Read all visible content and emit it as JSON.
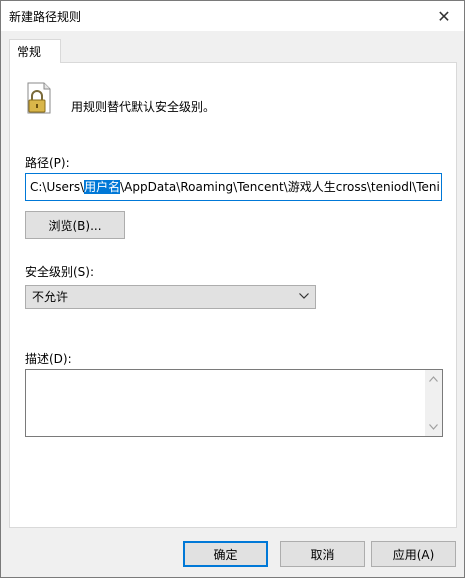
{
  "window": {
    "title": "新建路径规则",
    "close_glyph": "✕"
  },
  "tabs": [
    {
      "label": "常规"
    }
  ],
  "general": {
    "description": "用规则替代默认安全级别。",
    "path_label": "路径(P):",
    "path_value_prefix": "C:\\Users\\",
    "path_value_selected": "用户名",
    "path_value_suffix": "\\AppData\\Roaming\\Tencent\\游戏人生cross\\teniodl\\Teni",
    "browse_label": "浏览(B)...",
    "security_level_label": "安全级别(S):",
    "security_level_value": "不允许",
    "description_field_label": "描述(D):",
    "description_field_value": ""
  },
  "footer": {
    "ok_label": "确定",
    "cancel_label": "取消",
    "apply_label": "应用(A)"
  },
  "colors": {
    "accent": "#0078d7",
    "window_bg": "#f0f0f0",
    "button_bg": "#e1e1e1"
  },
  "icons": {
    "app_icon": "lock-document-icon",
    "close": "close-icon",
    "dropdown": "chevron-down-icon"
  }
}
